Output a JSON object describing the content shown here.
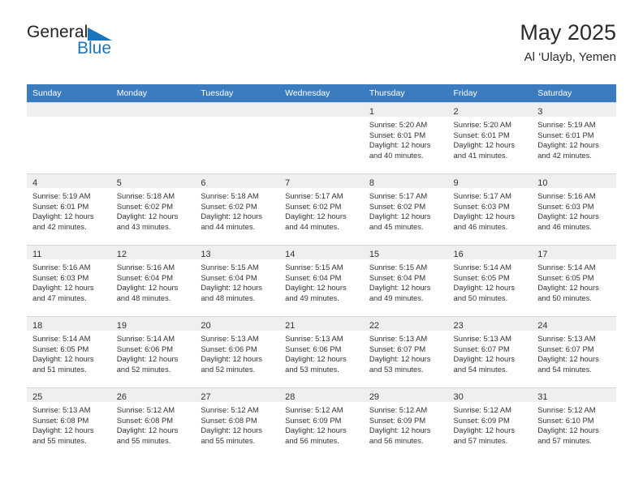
{
  "brand": {
    "line1": "General",
    "line2": "Blue",
    "triangle_color": "#1c74bb",
    "text_color": "#231f20"
  },
  "header": {
    "title": "May 2025",
    "subtitle": "Al ‘Ulayb, Yemen"
  },
  "theme": {
    "header_bg": "#3a7cbe",
    "daynum_bg": "#efefef",
    "grid_line": "#d5d5d5",
    "text": "#333333"
  },
  "weekday_headers": [
    "Sunday",
    "Monday",
    "Tuesday",
    "Wednesday",
    "Thursday",
    "Friday",
    "Saturday"
  ],
  "weeks": [
    [
      {
        "day": "",
        "lines": []
      },
      {
        "day": "",
        "lines": []
      },
      {
        "day": "",
        "lines": []
      },
      {
        "day": "",
        "lines": []
      },
      {
        "day": "1",
        "lines": [
          "Sunrise: 5:20 AM",
          "Sunset: 6:01 PM",
          "Daylight: 12 hours",
          "and 40 minutes."
        ]
      },
      {
        "day": "2",
        "lines": [
          "Sunrise: 5:20 AM",
          "Sunset: 6:01 PM",
          "Daylight: 12 hours",
          "and 41 minutes."
        ]
      },
      {
        "day": "3",
        "lines": [
          "Sunrise: 5:19 AM",
          "Sunset: 6:01 PM",
          "Daylight: 12 hours",
          "and 42 minutes."
        ]
      }
    ],
    [
      {
        "day": "4",
        "lines": [
          "Sunrise: 5:19 AM",
          "Sunset: 6:01 PM",
          "Daylight: 12 hours",
          "and 42 minutes."
        ]
      },
      {
        "day": "5",
        "lines": [
          "Sunrise: 5:18 AM",
          "Sunset: 6:02 PM",
          "Daylight: 12 hours",
          "and 43 minutes."
        ]
      },
      {
        "day": "6",
        "lines": [
          "Sunrise: 5:18 AM",
          "Sunset: 6:02 PM",
          "Daylight: 12 hours",
          "and 44 minutes."
        ]
      },
      {
        "day": "7",
        "lines": [
          "Sunrise: 5:17 AM",
          "Sunset: 6:02 PM",
          "Daylight: 12 hours",
          "and 44 minutes."
        ]
      },
      {
        "day": "8",
        "lines": [
          "Sunrise: 5:17 AM",
          "Sunset: 6:02 PM",
          "Daylight: 12 hours",
          "and 45 minutes."
        ]
      },
      {
        "day": "9",
        "lines": [
          "Sunrise: 5:17 AM",
          "Sunset: 6:03 PM",
          "Daylight: 12 hours",
          "and 46 minutes."
        ]
      },
      {
        "day": "10",
        "lines": [
          "Sunrise: 5:16 AM",
          "Sunset: 6:03 PM",
          "Daylight: 12 hours",
          "and 46 minutes."
        ]
      }
    ],
    [
      {
        "day": "11",
        "lines": [
          "Sunrise: 5:16 AM",
          "Sunset: 6:03 PM",
          "Daylight: 12 hours",
          "and 47 minutes."
        ]
      },
      {
        "day": "12",
        "lines": [
          "Sunrise: 5:16 AM",
          "Sunset: 6:04 PM",
          "Daylight: 12 hours",
          "and 48 minutes."
        ]
      },
      {
        "day": "13",
        "lines": [
          "Sunrise: 5:15 AM",
          "Sunset: 6:04 PM",
          "Daylight: 12 hours",
          "and 48 minutes."
        ]
      },
      {
        "day": "14",
        "lines": [
          "Sunrise: 5:15 AM",
          "Sunset: 6:04 PM",
          "Daylight: 12 hours",
          "and 49 minutes."
        ]
      },
      {
        "day": "15",
        "lines": [
          "Sunrise: 5:15 AM",
          "Sunset: 6:04 PM",
          "Daylight: 12 hours",
          "and 49 minutes."
        ]
      },
      {
        "day": "16",
        "lines": [
          "Sunrise: 5:14 AM",
          "Sunset: 6:05 PM",
          "Daylight: 12 hours",
          "and 50 minutes."
        ]
      },
      {
        "day": "17",
        "lines": [
          "Sunrise: 5:14 AM",
          "Sunset: 6:05 PM",
          "Daylight: 12 hours",
          "and 50 minutes."
        ]
      }
    ],
    [
      {
        "day": "18",
        "lines": [
          "Sunrise: 5:14 AM",
          "Sunset: 6:05 PM",
          "Daylight: 12 hours",
          "and 51 minutes."
        ]
      },
      {
        "day": "19",
        "lines": [
          "Sunrise: 5:14 AM",
          "Sunset: 6:06 PM",
          "Daylight: 12 hours",
          "and 52 minutes."
        ]
      },
      {
        "day": "20",
        "lines": [
          "Sunrise: 5:13 AM",
          "Sunset: 6:06 PM",
          "Daylight: 12 hours",
          "and 52 minutes."
        ]
      },
      {
        "day": "21",
        "lines": [
          "Sunrise: 5:13 AM",
          "Sunset: 6:06 PM",
          "Daylight: 12 hours",
          "and 53 minutes."
        ]
      },
      {
        "day": "22",
        "lines": [
          "Sunrise: 5:13 AM",
          "Sunset: 6:07 PM",
          "Daylight: 12 hours",
          "and 53 minutes."
        ]
      },
      {
        "day": "23",
        "lines": [
          "Sunrise: 5:13 AM",
          "Sunset: 6:07 PM",
          "Daylight: 12 hours",
          "and 54 minutes."
        ]
      },
      {
        "day": "24",
        "lines": [
          "Sunrise: 5:13 AM",
          "Sunset: 6:07 PM",
          "Daylight: 12 hours",
          "and 54 minutes."
        ]
      }
    ],
    [
      {
        "day": "25",
        "lines": [
          "Sunrise: 5:13 AM",
          "Sunset: 6:08 PM",
          "Daylight: 12 hours",
          "and 55 minutes."
        ]
      },
      {
        "day": "26",
        "lines": [
          "Sunrise: 5:12 AM",
          "Sunset: 6:08 PM",
          "Daylight: 12 hours",
          "and 55 minutes."
        ]
      },
      {
        "day": "27",
        "lines": [
          "Sunrise: 5:12 AM",
          "Sunset: 6:08 PM",
          "Daylight: 12 hours",
          "and 55 minutes."
        ]
      },
      {
        "day": "28",
        "lines": [
          "Sunrise: 5:12 AM",
          "Sunset: 6:09 PM",
          "Daylight: 12 hours",
          "and 56 minutes."
        ]
      },
      {
        "day": "29",
        "lines": [
          "Sunrise: 5:12 AM",
          "Sunset: 6:09 PM",
          "Daylight: 12 hours",
          "and 56 minutes."
        ]
      },
      {
        "day": "30",
        "lines": [
          "Sunrise: 5:12 AM",
          "Sunset: 6:09 PM",
          "Daylight: 12 hours",
          "and 57 minutes."
        ]
      },
      {
        "day": "31",
        "lines": [
          "Sunrise: 5:12 AM",
          "Sunset: 6:10 PM",
          "Daylight: 12 hours",
          "and 57 minutes."
        ]
      }
    ]
  ]
}
